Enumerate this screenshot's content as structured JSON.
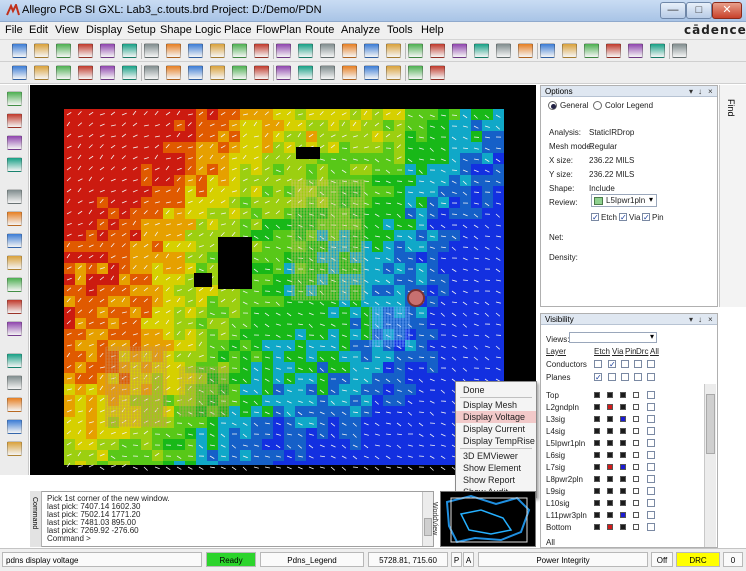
{
  "window": {
    "title": "Allegro PCB SI GXL: Lab3_c.touts.brd  Project: D:/Demo/PDN",
    "brand": "cādence"
  },
  "menu": [
    "File",
    "Edit",
    "View",
    "Display",
    "Setup",
    "Shape",
    "Logic",
    "Place",
    "FlowPlan",
    "Route",
    "Analyze",
    "Tools",
    "Help"
  ],
  "toolbar1_icons": [
    "new-icon",
    "open-icon",
    "save-icon",
    "move-icon",
    "copy-icon",
    "delete-icon",
    "undo-icon",
    "redo-icon",
    "pin-icon",
    "add-connect-icon",
    "grid-icon",
    "zoom-fit-icon",
    "zoom-in-icon",
    "zoom-out-icon",
    "zoom-world-icon",
    "zoom-prev-icon",
    "zoom-center-icon",
    "redraw-icon",
    "3d-icon",
    "layer-icon",
    "color-icon",
    "shadow-icon",
    "swap-icon",
    "drc-icon",
    "report-icon",
    "measure-icon",
    "info-icon",
    "highlight-icon",
    "dehighlight-icon",
    "grid-toggle-icon",
    "stats-icon"
  ],
  "toolbar2_icons": [
    "layout-icon",
    "place-icon",
    "group-icon",
    "pin-icon",
    "via-icon",
    "shape-icon",
    "text-icon",
    "frame-icon",
    "rect-icon",
    "line-icon",
    "arc-icon",
    "curve-icon",
    "ratsnest-icon",
    "net-icon",
    "bus-icon",
    "signal-icon",
    "diff-icon",
    "map-icon",
    "target-icon",
    "help-icon"
  ],
  "left_icons": [
    "select-icon",
    "pan-icon",
    "zoom-icon",
    "route-icon",
    "slide-icon",
    "add-icon",
    "fanout-icon",
    "bundle-icon",
    "glue-icon",
    "delay-icon",
    "spread-icon",
    "shape-icon",
    "fill-icon",
    "drill-icon",
    "cut-icon",
    "outline-icon"
  ],
  "context_menu": {
    "items": [
      "Done",
      "Display Mesh",
      "Display Voltage",
      "Display Current",
      "Display TempRise",
      "3D EMViewer",
      "Show Element",
      "Show Report",
      "Show Audit"
    ],
    "highlighted": "Display Voltage"
  },
  "options": {
    "header": "Options",
    "radio_general": "General",
    "radio_color_legend": "Color Legend",
    "fields": [
      {
        "label": "Analysis:",
        "value": "StaticIRDrop"
      },
      {
        "label": "Mesh mode:",
        "value": "Regular"
      },
      {
        "label": "X size:",
        "value": "236.22 MILS"
      },
      {
        "label": "Y size:",
        "value": "236.22 MILS"
      },
      {
        "label": "Shape:",
        "value": "Include"
      }
    ],
    "review_label": "Review:",
    "review_value": "L5Ipwr1pln",
    "review_swatch": "#8fd18f",
    "checks": [
      "Etch",
      "Via",
      "Pin"
    ],
    "net_label": "Net:",
    "density_label": "Density:"
  },
  "find_tab": "Find",
  "visibility": {
    "header": "Visibility",
    "views_label": "Views:",
    "layer_label": "Layer",
    "col_labels": [
      "Etch",
      "Via",
      "Pin",
      "Drc",
      "All"
    ],
    "conductors_label": "Conductors",
    "planes_label": "Planes",
    "layers": [
      "Top",
      "L2gndpln",
      "L3sig",
      "L4sig",
      "L5Ipwr1pln",
      "L6sig",
      "L7sig",
      "L8pwr2pln",
      "L9sig",
      "L10sig",
      "L11pwr3pln",
      "Bottom"
    ],
    "all_label": "All",
    "swatch_colors": [
      "#1b1bd1",
      "#d11b1b",
      "#1b1b1b",
      "#888888"
    ]
  },
  "command": {
    "lines": [
      "Pick 1st corner of the new window.",
      "last pick:  7407.14  1602.30",
      "last pick:  7502.14  1771.20",
      "last pick:  7481.03  895.00",
      "last pick:  7269.92  -276.60",
      "Command >"
    ],
    "side_label": "Command"
  },
  "worldview_label": "WorldView",
  "statusbar": {
    "command": "pdns display voltage",
    "state": "Ready",
    "legend": "Pdns_Legend",
    "coords": "5728.81, 715.60",
    "p_btn": "P",
    "a_btn": "A",
    "mode": "Power Integrity",
    "off": "Off",
    "drc": "DRC",
    "count": "0"
  },
  "colors": {
    "ready": "#2cd42c",
    "drc": "#ffff00",
    "highlight": "#f2c9c9"
  }
}
